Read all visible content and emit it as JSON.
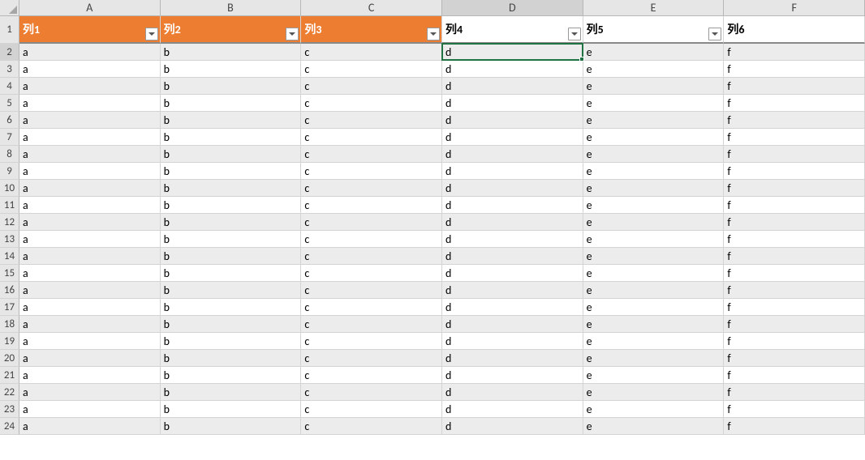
{
  "columns": [
    "A",
    "B",
    "C",
    "D",
    "E",
    "F"
  ],
  "headerRow": [
    "列1",
    "列2",
    "列3",
    "列4",
    "列5",
    "列6"
  ],
  "headerOrangeCols": [
    0,
    1,
    2
  ],
  "filterCols": [
    0,
    1,
    2,
    3,
    4
  ],
  "rowCount": 23,
  "rowValues": [
    "a",
    "b",
    "c",
    "d",
    "e",
    "f"
  ],
  "activeCell": {
    "row": 2,
    "col": 3
  },
  "selectedColHeader": "D",
  "selectedRowHeader": 2,
  "colors": {
    "orange": "#ed7d31",
    "stripe": "#ececec",
    "selectionBorder": "#217346"
  }
}
